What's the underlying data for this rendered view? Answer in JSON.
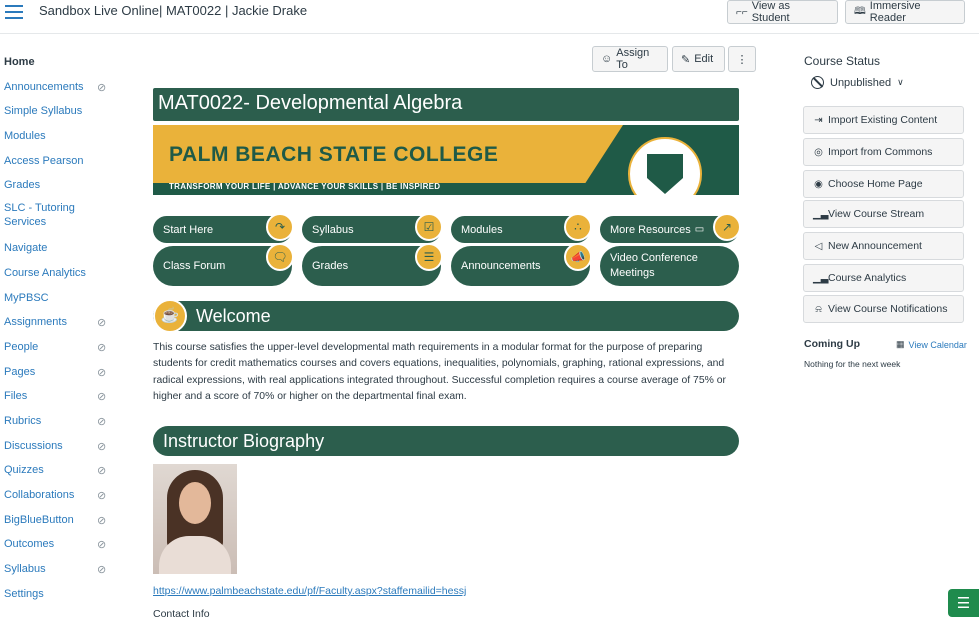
{
  "header": {
    "breadcrumb": "Sandbox Live Online| MAT0022 | Jackie Drake",
    "view_as_student": "View as Student",
    "immersive_reader": "Immersive Reader"
  },
  "nav": {
    "items": [
      {
        "label": "Home"
      },
      {
        "label": "Announcements"
      },
      {
        "label": "Simple Syllabus"
      },
      {
        "label": "Modules"
      },
      {
        "label": "Access Pearson"
      },
      {
        "label": "Grades"
      },
      {
        "label": "SLC - Tutoring Services"
      },
      {
        "label": "Navigate"
      },
      {
        "label": "Course Analytics"
      },
      {
        "label": "MyPBSC"
      },
      {
        "label": "Assignments"
      },
      {
        "label": "People"
      },
      {
        "label": "Pages"
      },
      {
        "label": "Files"
      },
      {
        "label": "Rubrics"
      },
      {
        "label": "Discussions"
      },
      {
        "label": "Quizzes"
      },
      {
        "label": "Collaborations"
      },
      {
        "label": "BigBlueButton"
      },
      {
        "label": "Outcomes"
      },
      {
        "label": "Syllabus"
      },
      {
        "label": "Settings"
      }
    ]
  },
  "toolbar": {
    "assign_to": "Assign To",
    "edit": "Edit",
    "more": "⋮"
  },
  "page": {
    "title": "MAT0022- Developmental Algebra",
    "banner_college": "PALM BEACH STATE COLLEGE",
    "banner_tagline": "TRANSFORM YOUR LIFE  |  ADVANCE YOUR SKILLS  |  BE INSPIRED",
    "buttons": {
      "start_here": "Start Here",
      "syllabus": "Syllabus",
      "modules": "Modules",
      "more_resources": "More Resources",
      "class_forum": "Class Forum",
      "grades": "Grades",
      "announcements": "Announcements",
      "video_conference": "Video Conference Meetings"
    },
    "welcome": "Welcome",
    "welcome_text": "This course satisfies the upper-level developmental math requirements in a modular format for the purpose of preparing students for credit mathematics courses and covers equations, inequalities, polynomials, graphing, rational expressions, and radical expressions, with real applications integrated throughout. Successful completion requires a course average of 75% or higher and a score of 70% or higher on the departmental final exam.",
    "instructor_bio": "Instructor Biography",
    "faculty_link": "https://www.palmbeachstate.edu/pf/Faculty.aspx?staffemailid=hessj",
    "contact_info": "Contact Info"
  },
  "sidebar": {
    "course_status": "Course Status",
    "unpublished": "Unpublished",
    "buttons": [
      {
        "label": "Import Existing Content",
        "icon": "import-icon"
      },
      {
        "label": "Import from Commons",
        "icon": "commons-icon"
      },
      {
        "label": "Choose Home Page",
        "icon": "target-icon"
      },
      {
        "label": "View Course Stream",
        "icon": "stats-icon"
      },
      {
        "label": "New Announcement",
        "icon": "megaphone-icon"
      },
      {
        "label": "Course Analytics",
        "icon": "stats-icon"
      },
      {
        "label": "View Course Notifications",
        "icon": "bell-icon"
      }
    ],
    "coming_up": "Coming Up",
    "view_calendar": "View Calendar",
    "nothing": "Nothing for the next week"
  },
  "colors": {
    "green": "#2c5e4d",
    "gold": "#eab23a",
    "link": "#2b7abc"
  }
}
